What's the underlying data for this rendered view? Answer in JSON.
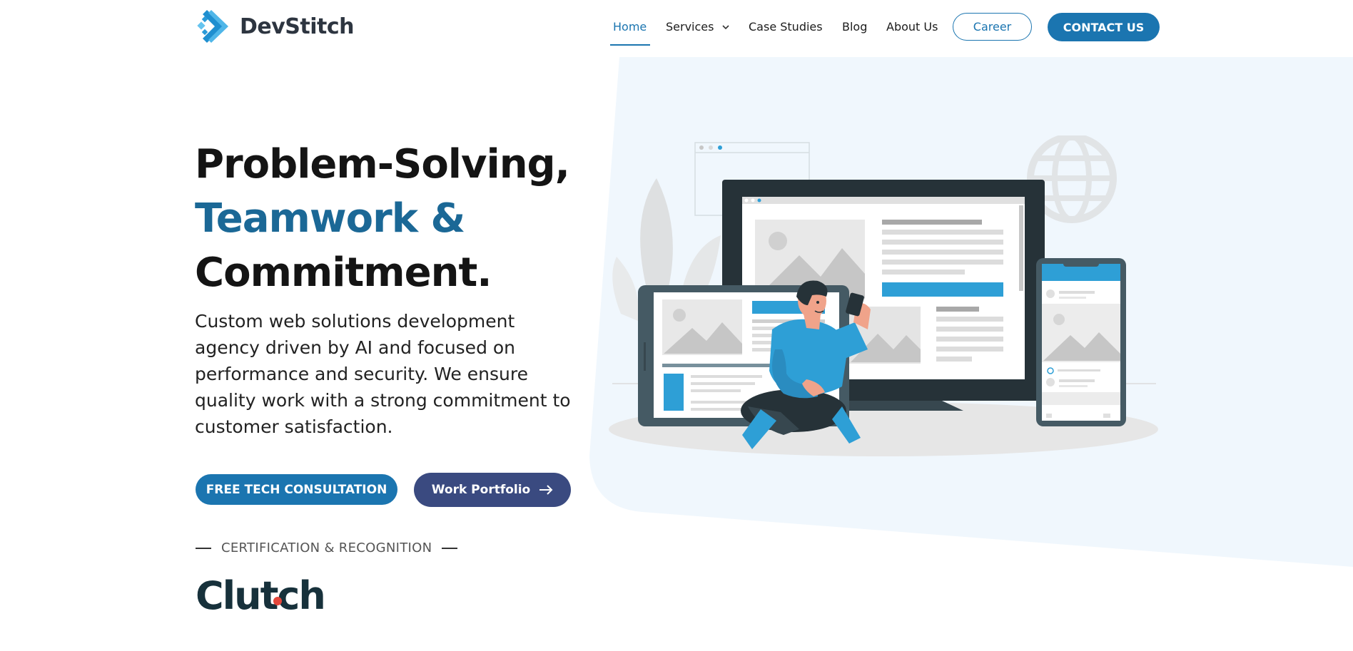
{
  "brand": {
    "name": "DevStitch"
  },
  "nav": {
    "items": [
      {
        "label": "Home",
        "active": true
      },
      {
        "label": "Services",
        "has_dropdown": true
      },
      {
        "label": "Case Studies"
      },
      {
        "label": "Blog"
      },
      {
        "label": "About Us"
      }
    ],
    "career_label": "Career",
    "contact_label": "CONTACT US"
  },
  "hero": {
    "title_line1": "Problem-Solving,",
    "title_line2": "Teamwork &",
    "title_line3": "Commitment.",
    "description": "Custom web solutions development agency driven by AI and focused on performance and security. We ensure quality work with a strong commitment to customer satisfaction.",
    "cta_primary": "FREE TECH CONSULTATION",
    "cta_secondary": "Work Portfolio"
  },
  "certification": {
    "heading": "CERTIFICATION & RECOGNITION",
    "badge": "Clutch"
  },
  "colors": {
    "primary": "#1b75b0",
    "accent_title": "#1b6896",
    "portfolio_button": "#3a4a80",
    "hero_panel": "#eef6fc",
    "clutch_dot": "#e5473b"
  },
  "icons": [
    "devstitch-logo-icon",
    "chevron-down-icon",
    "arrow-right-icon",
    "clutch-logo"
  ]
}
